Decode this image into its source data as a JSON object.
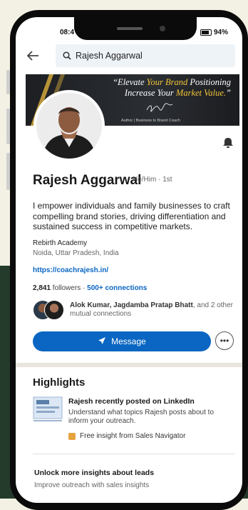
{
  "status": {
    "time": "08:4",
    "battery": "94%"
  },
  "search": {
    "query": "Rajesh Aggarwal"
  },
  "banner": {
    "line1_a": "“Elevate ",
    "line1_b": "Your Brand",
    "line1_c": " Positioning",
    "line2_a": "Increase Your ",
    "line2_b": "Market Value.",
    "line2_c": "”",
    "author": "Author | Business to Brand Coach"
  },
  "profile": {
    "name": "Rajesh Aggarwal",
    "pronoun_degree": "He/Him · 1st",
    "bio": "I empower individuals and family businesses to craft compelling brand stories, driving differentiation and sustained success in competitive markets.",
    "company": "Rebirth Academy",
    "location": "Noida, Uttar Pradesh, India",
    "website": "https://coachrajesh.in/",
    "followers_count": "2,841",
    "followers_label": " followers · ",
    "connections": "500+ connections",
    "mutual_names": "Alok Kumar, Jagdamba Pratap Bhatt",
    "mutual_suffix": ", and 2 other mutual connections"
  },
  "actions": {
    "message": "Message"
  },
  "highlights": {
    "title": "Highlights",
    "headline": "Rajesh recently posted on LinkedIn",
    "description": "Understand what topics Rajesh posts about to inform your outreach.",
    "insight": "Free insight from Sales Navigator"
  },
  "unlock": {
    "title": "Unlock more insights about leads",
    "subtitle": "Improve outreach with sales insights"
  },
  "colors": {
    "accent": "#0a66c2",
    "banner_gold": "#f2c438"
  }
}
